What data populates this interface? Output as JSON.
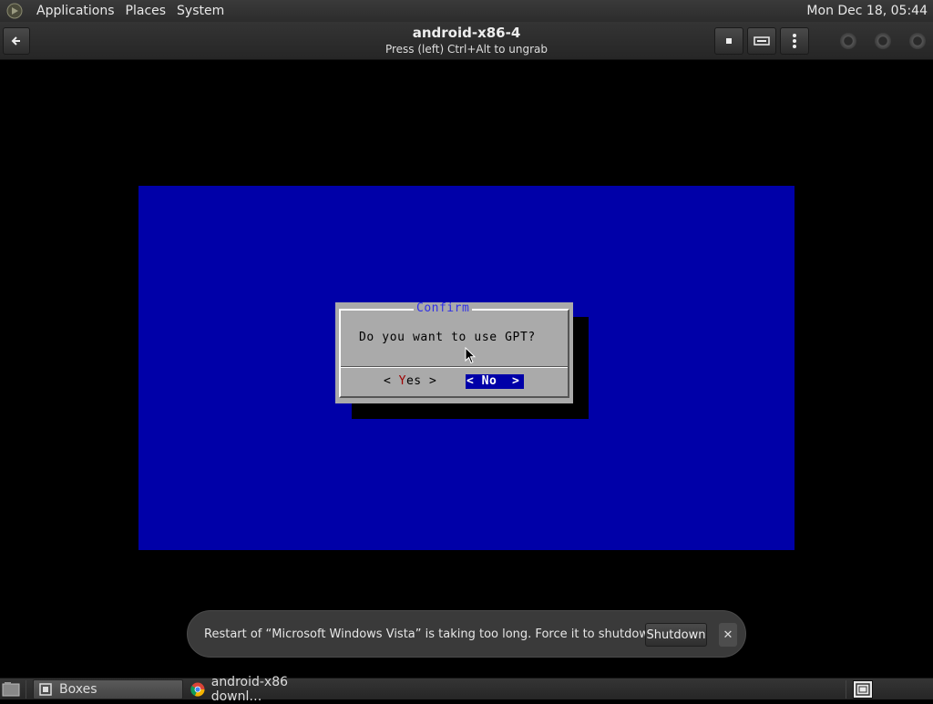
{
  "topbar": {
    "menus": [
      "Applications",
      "Places",
      "System"
    ],
    "clock": "Mon Dec 18, 05:44"
  },
  "header": {
    "title": "android-x86-4",
    "subtitle": "Press (left) Ctrl+Alt to ungrab"
  },
  "vm": {
    "dialog": {
      "title": "Confirm",
      "question": "Do you want to use GPT?",
      "yes_prefix": "< ",
      "yes_hot": "Y",
      "yes_rest": "es >",
      "no_label": "< No  >"
    },
    "colors": {
      "screen": "#0000a8",
      "dialog": "#aaaaaa"
    }
  },
  "notification": {
    "message": "Restart of “Microsoft Windows Vista” is taking too long. Force it to shutdown?",
    "shutdown_label": "Shutdown",
    "close_label": "✕"
  },
  "taskbar": {
    "items": [
      {
        "label": "Boxes",
        "icon": "boxes-icon",
        "active": true
      },
      {
        "label": "android-x86 downl…",
        "icon": "chrome-icon",
        "active": false
      }
    ]
  }
}
